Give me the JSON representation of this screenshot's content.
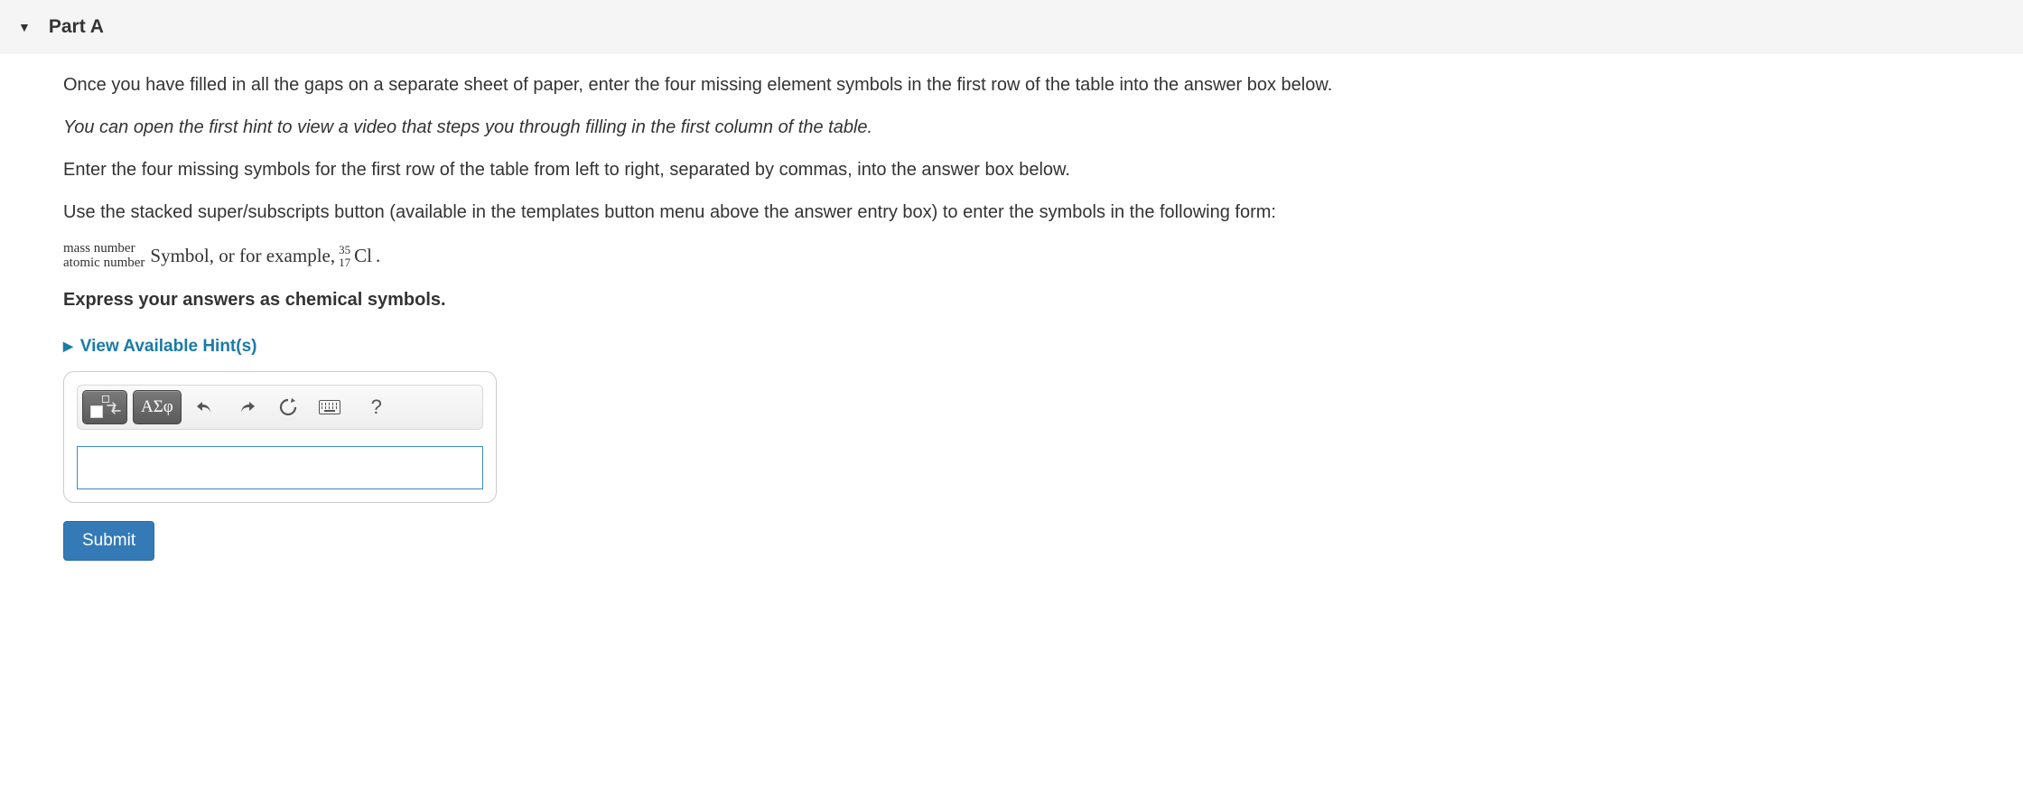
{
  "part": {
    "label": "Part A"
  },
  "instructions": {
    "p1": "Once you have filled in all the gaps on a separate sheet of paper, enter the four missing element symbols in the first row of the table into the answer box below.",
    "p2_italic": "You can open the first hint to view a video that steps you through filling in the first column of the table.",
    "p3": "Enter the four missing symbols for the first row of the table from left to right, separated by commas, into the answer box below.",
    "p4": "Use the stacked super/subscripts button (available in the templates button menu above the answer entry box) to enter the symbols in the following form:"
  },
  "notation": {
    "top_label": "mass number",
    "bottom_label": "atomic number",
    "middle_text": "Symbol, or for example, ",
    "ex_top": "35",
    "ex_bottom": "17",
    "ex_symbol": "Cl",
    "period": "."
  },
  "express": "Express your answers as chemical symbols.",
  "hints_label": "View Available Hint(s)",
  "toolbar": {
    "greek_label": "ΑΣφ",
    "help_label": "?"
  },
  "answer_value": "",
  "submit_label": "Submit"
}
